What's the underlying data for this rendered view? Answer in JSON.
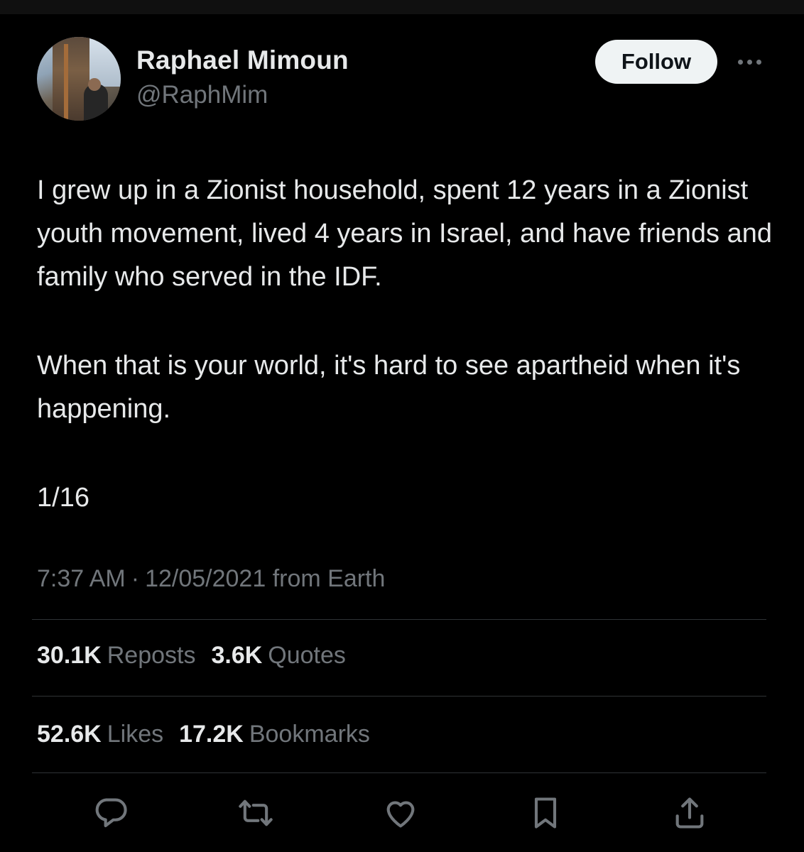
{
  "author": {
    "display_name": "Raphael Mimoun",
    "handle": "@RaphMim",
    "follow_label": "Follow"
  },
  "tweet": {
    "paragraphs": [
      "I grew up in a Zionist household, spent 12 years in a Zionist youth movement, lived 4 years in Israel, and have friends and family who served in the IDF.",
      "When that is your world, it's hard to see apartheid when it's happening.",
      "1/16"
    ],
    "time": "7:37 AM",
    "separator": "·",
    "date": "12/05/2021",
    "source": "from Earth"
  },
  "stats": {
    "reposts_count": "30.1K",
    "reposts_label": "Reposts",
    "quotes_count": "3.6K",
    "quotes_label": "Quotes",
    "likes_count": "52.6K",
    "likes_label": "Likes",
    "bookmarks_count": "17.2K",
    "bookmarks_label": "Bookmarks"
  },
  "actions": [
    {
      "icon": "reply-icon"
    },
    {
      "icon": "repost-icon"
    },
    {
      "icon": "like-icon"
    },
    {
      "icon": "bookmark-icon"
    },
    {
      "icon": "share-icon"
    }
  ],
  "colors": {
    "background": "#000000",
    "primary_text": "#e7e9ea",
    "secondary_text": "#71767b",
    "divider": "#2f3336",
    "follow_button_bg": "#eff3f4"
  }
}
